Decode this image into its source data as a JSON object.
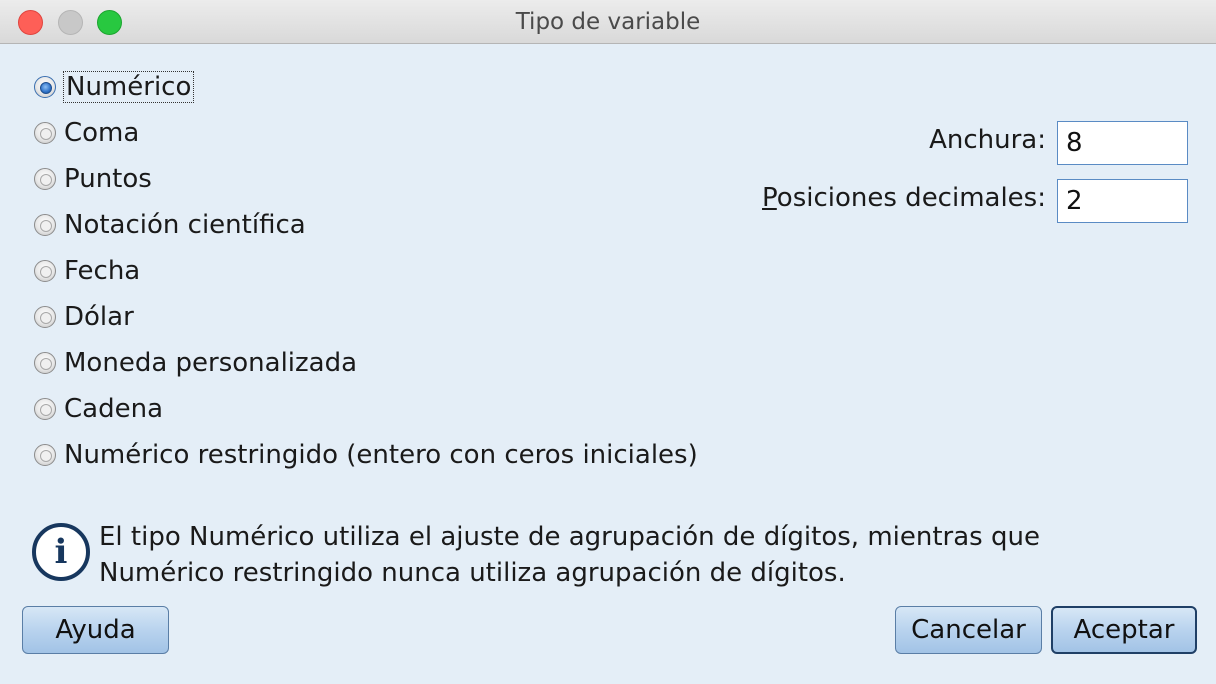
{
  "window": {
    "title": "Tipo de variable"
  },
  "types": [
    {
      "label": "Numérico",
      "selected": true
    },
    {
      "label": "Coma",
      "selected": false
    },
    {
      "label": "Puntos",
      "selected": false
    },
    {
      "label": "Notación científica",
      "selected": false
    },
    {
      "label": "Fecha",
      "selected": false
    },
    {
      "label": "Dólar",
      "selected": false
    },
    {
      "label": "Moneda personalizada",
      "selected": false
    },
    {
      "label": "Cadena",
      "selected": false
    },
    {
      "label": "Numérico restringido (entero con ceros iniciales)",
      "selected": false
    }
  ],
  "fields": {
    "width": {
      "label": "Anchura:",
      "value": "8"
    },
    "decimals": {
      "label_mnemonic": "P",
      "label_rest": "osiciones decimales:",
      "value": "2"
    }
  },
  "info": {
    "icon": "info-icon",
    "line1": "El tipo Numérico utiliza el ajuste de agrupación de dígitos, mientras que",
    "line2": "Numérico restringido nunca utiliza agrupación de dígitos."
  },
  "buttons": {
    "help": "Ayuda",
    "cancel": "Cancelar",
    "ok": "Aceptar"
  }
}
